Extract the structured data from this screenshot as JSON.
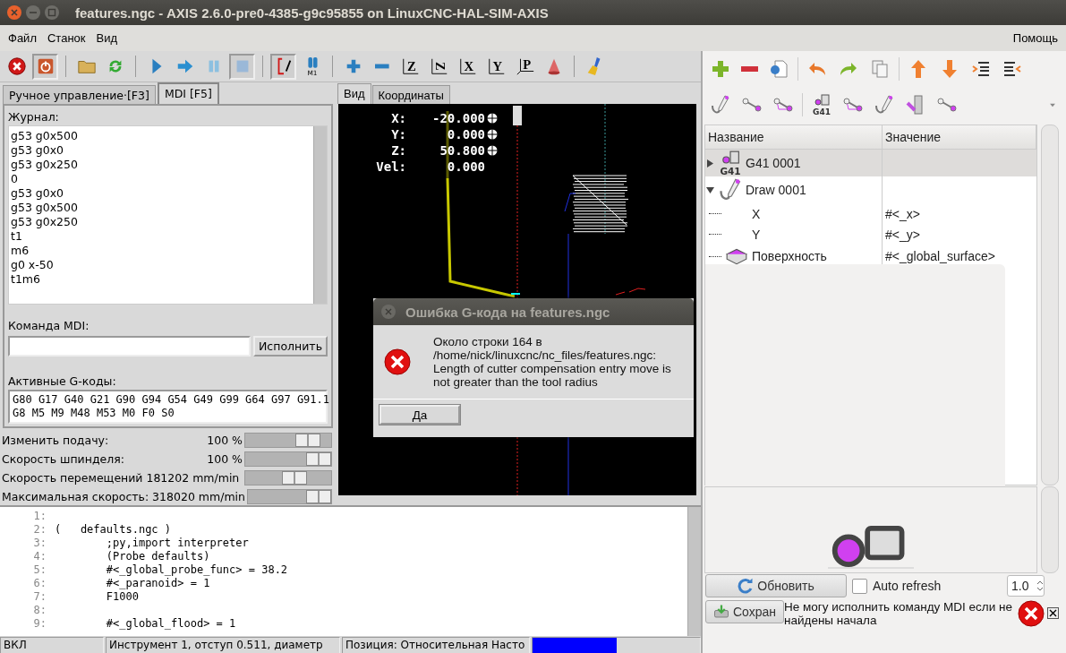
{
  "window": {
    "title": "features.ngc - AXIS 2.6.0-pre0-4385-g9c95855 on LinuxCNC-HAL-SIM-AXIS"
  },
  "menu": {
    "items": [
      "Файл",
      "Станок",
      "Вид"
    ],
    "help": "Помощь"
  },
  "toolbar": [
    {
      "kind": "estop",
      "pressed": false
    },
    {
      "kind": "power",
      "pressed": true
    },
    {
      "kind": "separator"
    },
    {
      "kind": "open",
      "pressed": false
    },
    {
      "kind": "reload",
      "pressed": false
    },
    {
      "kind": "separator"
    },
    {
      "kind": "run",
      "pressed": false
    },
    {
      "kind": "step",
      "pressed": false
    },
    {
      "kind": "pause",
      "pressed": false
    },
    {
      "kind": "stop",
      "pressed": true
    },
    {
      "kind": "separator"
    },
    {
      "kind": "block_delete",
      "pressed": true
    },
    {
      "kind": "optional_stop",
      "glyph": "M1",
      "pressed": false
    },
    {
      "kind": "separator"
    },
    {
      "kind": "zoom_in",
      "pressed": false
    },
    {
      "kind": "zoom_out",
      "pressed": false
    },
    {
      "kind": "view",
      "glyph": "Z",
      "pressed": false
    },
    {
      "kind": "view_rotated",
      "glyph": "Z",
      "pressed": false
    },
    {
      "kind": "view",
      "glyph": "X",
      "pressed": false
    },
    {
      "kind": "view",
      "glyph": "Y",
      "pressed": false
    },
    {
      "kind": "view_perspective",
      "glyph": "P",
      "pressed": false
    },
    {
      "kind": "rotate",
      "pressed": false
    },
    {
      "kind": "separator"
    },
    {
      "kind": "clear",
      "pressed": false
    }
  ],
  "control_tabs": [
    {
      "label": "Ручное управление·[F3]",
      "selected": false
    },
    {
      "label": "MDI [F5]",
      "selected": true
    }
  ],
  "mdi": {
    "history_label": "Журнал:",
    "history": [
      "g53 g0x500",
      "g53 g0x0",
      "g53 g0x250",
      "0",
      "g53 g0x0",
      "g53 g0x500",
      "g53 g0x250",
      "t1",
      "m6",
      "g0 x-50",
      "t1m6"
    ],
    "command_label": "Команда MDI:",
    "execute_button": "Исполнить",
    "active_codes_label": "Активные G-коды:",
    "active_codes": [
      "G80 G17 G40 G21 G90 G94 G54 G49 G99 G64 G97 G91.1",
      "G8 M5 M9 M48 M53 M0 F0 S0"
    ]
  },
  "overrides": [
    {
      "label": "Изменить подачу:",
      "reading": "100 %",
      "level": 0.83
    },
    {
      "label": "Скорость шпинделя:",
      "reading": "100 %",
      "level": 1
    },
    {
      "label": "Скорость перемещений 181202 mm/min",
      "level": 0.61
    },
    {
      "label": "Максимальная скорость: 318020 mm/min",
      "level": 1
    }
  ],
  "view_tabs": [
    {
      "label": "Вид",
      "selected": true
    },
    {
      "label": "Координаты",
      "selected": false
    }
  ],
  "dro": [
    {
      "axis": "X:",
      "value": "-20.000",
      "homed": true
    },
    {
      "axis": "Y:",
      "value": "0.000",
      "homed": true
    },
    {
      "axis": "Z:",
      "value": "50.800",
      "homed": true
    },
    {
      "axis": "Vel:",
      "value": "0.000",
      "homed": false
    }
  ],
  "program": [
    {
      "number": "1:"
    },
    {
      "number": "2:",
      "text": "(   defaults.ngc )"
    },
    {
      "number": "3:",
      "text": "\t;py,import interpreter"
    },
    {
      "number": "4:",
      "text": "\t(Probe defaults)"
    },
    {
      "number": "5:",
      "text": "\t#<_global_probe_func> = 38.2"
    },
    {
      "number": "6:",
      "text": "\t#<_paranoid> = 1"
    },
    {
      "number": "7:",
      "text": "\tF1000"
    },
    {
      "number": "8:"
    },
    {
      "number": "9:",
      "text": "\t#<_global_flood> = 1"
    }
  ],
  "status_bar": {
    "segments": [
      "ВКЛ",
      "Инструмент 1, отступ 0.511, диаметр",
      "Позиция: Относительная Насто"
    ],
    "progress": {
      "level": 0.5
    }
  },
  "editor_toolbar": [
    [
      {
        "kind": "add"
      },
      {
        "kind": "remove"
      },
      {
        "kind": "import"
      },
      {
        "kind": "separator"
      },
      {
        "kind": "undo"
      },
      {
        "kind": "redo"
      },
      {
        "kind": "copy"
      },
      {
        "kind": "separator"
      },
      {
        "kind": "up"
      },
      {
        "kind": "down"
      },
      {
        "kind": "indent"
      },
      {
        "kind": "unindent"
      }
    ],
    [
      {
        "kind": "pencil"
      },
      {
        "kind": "line"
      },
      {
        "kind": "triangle_line"
      },
      {
        "kind": "separator"
      },
      {
        "kind": "g41",
        "glyph": "G41"
      },
      {
        "kind": "triangle_line"
      },
      {
        "kind": "pencil"
      },
      {
        "kind": "tool"
      },
      {
        "kind": "line"
      },
      {
        "kind": "more"
      }
    ]
  ],
  "tree": {
    "columns": [
      "Название",
      "Значение"
    ],
    "rows": [
      {
        "name": "G41 0001",
        "kind": "g41",
        "glyph": "G41",
        "expanded": false,
        "selected": true
      },
      {
        "name": "Draw 0001",
        "kind": "pencil",
        "expanded": true,
        "selected": false,
        "children": [
          {
            "name": "X",
            "value": "#<_x>",
            "selected": false
          },
          {
            "name": "Y",
            "value": "#<_y>",
            "selected": false
          },
          {
            "name": "Поверхность",
            "kind": "surface",
            "value": "#<_global_surface>",
            "selected": false
          }
        ]
      }
    ]
  },
  "refresh_button": "Обновить",
  "auto_refresh": {
    "label": "Auto refresh",
    "checked": false
  },
  "interval": {
    "value": "1.0"
  },
  "save_button": "Сохран",
  "notification": {
    "message": "Не могу исполнить команду MDI если не найдены начала"
  },
  "dialog": {
    "title": "Ошибка G-кода на features.ngc",
    "message": [
      "Около строки 164 в",
      "/home/nick/linuxcnc/nc_files/features.ngc:",
      "Length of cutter compensation entry move is",
      "not greater than the tool radius"
    ],
    "button": "Да"
  }
}
